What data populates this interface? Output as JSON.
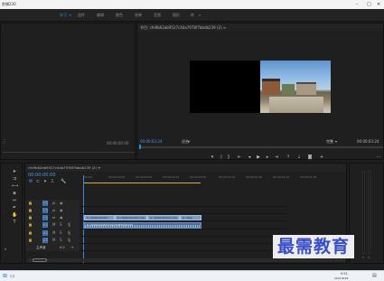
{
  "window": {
    "title": "剪辑230"
  },
  "workspaces": [
    {
      "label": "学习",
      "active": true
    },
    {
      "label": "组件"
    },
    {
      "label": "编辑"
    },
    {
      "label": "颜色"
    },
    {
      "label": "效果"
    },
    {
      "label": "音频"
    },
    {
      "label": "图形"
    },
    {
      "label": "库"
    }
  ],
  "source_panel": {
    "timecode": "00:00:00:00"
  },
  "program_monitor": {
    "title": "节目: cfe9b62ab9527c4da7978f7bbdb239 (2) ≡",
    "timecode": "00:00:03:24",
    "fit": "适合",
    "quality": "完整",
    "duration": "00:00:03:24"
  },
  "timeline": {
    "tab_title": "cfe9b62ab9527c4da7978f7bbdb239 (2) ≡",
    "timecode": "00:00:00:00",
    "ruler_ticks": [
      ":00:00",
      "00:00:00:05",
      "00:00:00:10",
      "00:00:00:15",
      "00:00:00:20",
      "00:00:01:00",
      "00:00:01:05",
      "00:00:01:10",
      "00:00:01:15"
    ],
    "tracks": [
      {
        "name": "V3"
      },
      {
        "name": "V2"
      },
      {
        "name": "V1"
      },
      {
        "name": "A1"
      },
      {
        "name": "A2"
      },
      {
        "name": "A3"
      },
      {
        "name": "主声道",
        "level": "0.0"
      }
    ],
    "video_clips": [
      {
        "label": "fx cfe9b62ab9527"
      },
      {
        "label": "fx cfe9b62ab9527c4da"
      },
      {
        "label": "fx cfe9b62ab9527c4da"
      },
      {
        "label": "fx cfe9b"
      }
    ],
    "audio_clip_label": "fx cfe9b62ab9527c4da7978f7bbdb239"
  },
  "taskbar": {
    "time": "9:51",
    "date": "2021/8/28"
  },
  "watermark": "最需教育",
  "colors": {
    "accent": "#3b86d8",
    "timecode": "#4a9be8",
    "clip_video": "#7a9cc4",
    "clip_audio": "#4e6f9a",
    "watermark": "#3a4dc9"
  }
}
